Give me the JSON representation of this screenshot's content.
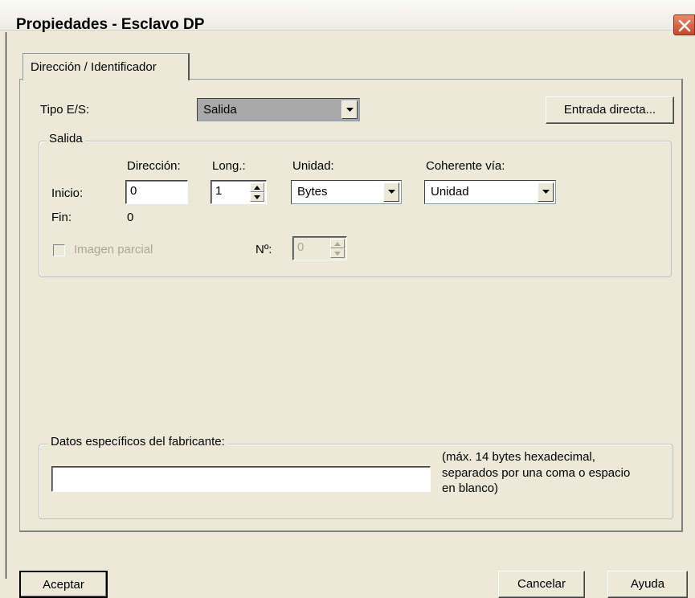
{
  "window": {
    "title": "Propiedades - Esclavo DP",
    "close_icon": "close-icon"
  },
  "tabs": [
    {
      "label": "Dirección / Identificador",
      "selected": true
    }
  ],
  "io_type": {
    "label": "Tipo E/S:",
    "value": "Salida",
    "direct_input_button": "Entrada directa..."
  },
  "output_group": {
    "legend": "Salida",
    "headers": {
      "address": "Dirección:",
      "length": "Long.:",
      "unit": "Unidad:",
      "consistent": "Coherente vía:"
    },
    "start_label": "Inicio:",
    "start_address": "0",
    "length_value": "1",
    "unit_value": "Bytes",
    "consistent_value": "Unidad",
    "end_label": "Fin:",
    "end_value": "0",
    "partial_image_label": "Imagen parcial",
    "partial_image_checked": false,
    "number_label": "Nº:",
    "number_value": "0"
  },
  "manufacturer_group": {
    "legend": "Datos específicos del fabricante:",
    "value": "",
    "hint_line1": "(máx. 14 bytes hexadecimal,",
    "hint_line2": "separados por una coma o espacio",
    "hint_line3": "en blanco)"
  },
  "footer": {
    "accept_label": "Aceptar",
    "cancel_label": "Cancelar",
    "help_label": "Ayuda"
  },
  "colors": {
    "dialog_bg": "#ece9d8",
    "close_button": "#c9472a",
    "selected_combo": "#a9a9a9",
    "disabled_text": "#aca899"
  }
}
